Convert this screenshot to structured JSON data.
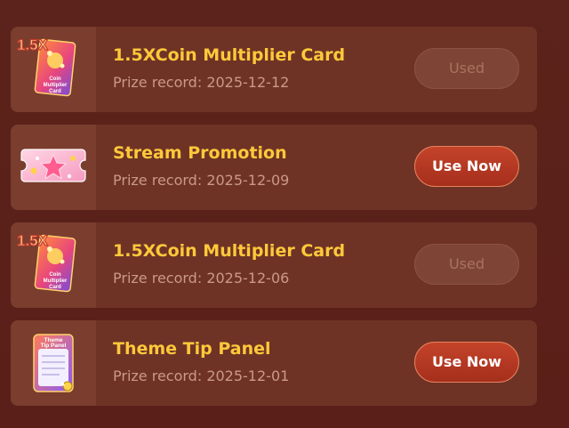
{
  "colors": {
    "background": "#5a2019",
    "card": "#6f3326",
    "thumb_panel": "#7a3d2e",
    "title": "#ffc93a",
    "record": "#c99a84",
    "used_button_bg": "#7e4536",
    "used_button_text": "#a8735f",
    "use_now_button_bg": "#b83a24",
    "use_now_button_text": "#ffffff"
  },
  "prizes": [
    {
      "icon": "multiplier-card-icon",
      "icon_text_big": "1.5X",
      "icon_text_small": "Coin Multiplier Card",
      "title": "1.5XCoin Multiplier Card",
      "record_label": "Prize record:",
      "record_date": "2025-12-12",
      "button": "Used",
      "state": "used"
    },
    {
      "icon": "stream-promotion-ticket-icon",
      "title": "Stream Promotion",
      "record_label": "Prize record:",
      "record_date": "2025-12-09",
      "button": "Use Now",
      "state": "available"
    },
    {
      "icon": "multiplier-card-icon",
      "icon_text_big": "1.5X",
      "icon_text_small": "Coin Multiplier Card",
      "title": "1.5XCoin Multiplier Card",
      "record_label": "Prize record:",
      "record_date": "2025-12-06",
      "button": "Used",
      "state": "used"
    },
    {
      "icon": "theme-tip-panel-icon",
      "icon_text_small": "Theme Tip Panel",
      "title": "Theme Tip Panel",
      "record_label": "Prize record:",
      "record_date": "2025-12-01",
      "button": "Use Now",
      "state": "available"
    }
  ]
}
